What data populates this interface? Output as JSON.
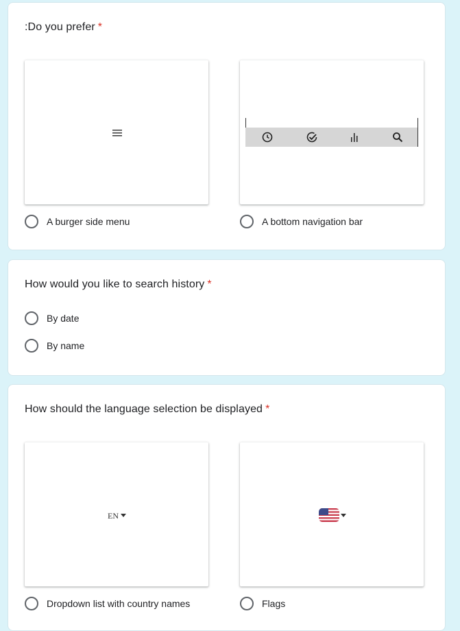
{
  "questions": [
    {
      "title": ":Do you prefer",
      "required_mark": "*",
      "options": [
        {
          "label": "A burger side menu",
          "image_icon": "hamburger-menu-icon"
        },
        {
          "label": "A bottom navigation bar",
          "image_icons": [
            "clock-icon",
            "check-circle-icon",
            "bar-chart-icon",
            "search-icon"
          ]
        }
      ]
    },
    {
      "title": "How would you like to search history",
      "required_mark": "*",
      "options": [
        {
          "label": "By date"
        },
        {
          "label": "By name"
        }
      ]
    },
    {
      "title": "How should the language selection be displayed",
      "required_mark": "*",
      "options": [
        {
          "label": "Dropdown list with country names",
          "image_text": "EN"
        },
        {
          "label": "Flags",
          "image_icon": "us-flag-icon"
        }
      ]
    }
  ],
  "colors": {
    "background": "#dbf3f9",
    "required": "#d93025",
    "radio_border": "#5f6368",
    "nav_bar": "#d6d6d6"
  }
}
